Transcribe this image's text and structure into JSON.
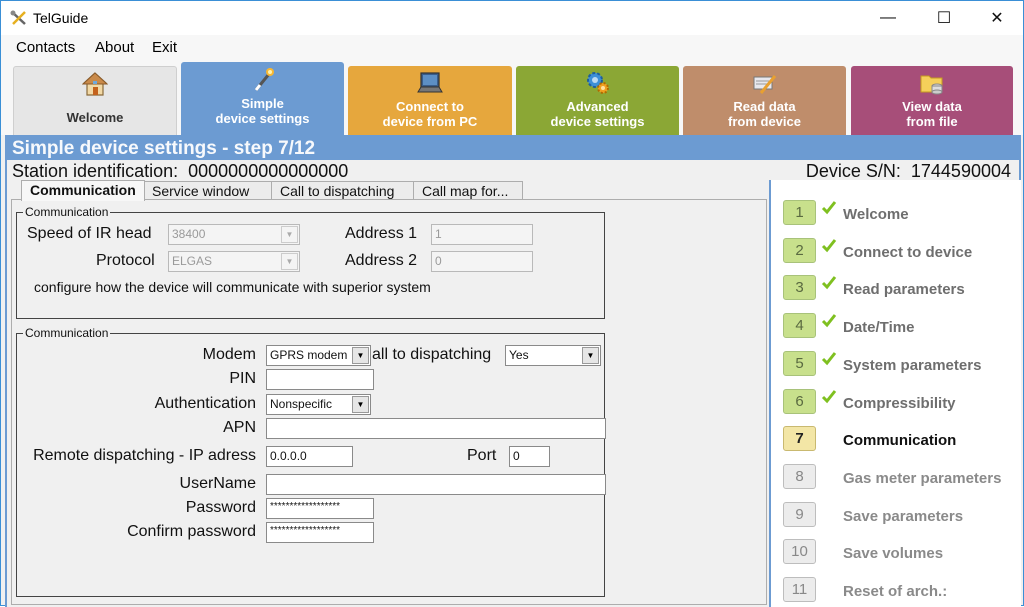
{
  "window": {
    "title": "TelGuide",
    "controls": {
      "minimize": "—",
      "maximize": "☐",
      "close": "✕"
    }
  },
  "menu": {
    "items": [
      "Contacts",
      "About",
      "Exit"
    ]
  },
  "ribbon": {
    "tabs": [
      {
        "label_line1": "Welcome",
        "label_line2": "",
        "icon": "house-icon",
        "color": "#e6e6e6"
      },
      {
        "label_line1": "Simple",
        "label_line2": "device settings",
        "icon": "magic-wand-icon",
        "color": "#6c9bd2",
        "active": true
      },
      {
        "label_line1": "Connect to",
        "label_line2": "device from PC",
        "icon": "laptop-icon",
        "color": "#e6a73d"
      },
      {
        "label_line1": "Advanced",
        "label_line2": "device settings",
        "icon": "gears-icon",
        "color": "#8ba735"
      },
      {
        "label_line1": "Read data",
        "label_line2": "from device",
        "icon": "read-pencil-icon",
        "color": "#bf8d6b"
      },
      {
        "label_line1": "View data",
        "label_line2": "from file",
        "icon": "folder-database-icon",
        "color": "#a74e79"
      }
    ]
  },
  "header": {
    "step_title": "Simple device settings - step 7/12",
    "station_label": "Station identification:",
    "station_value": "0000000000000000",
    "serial_label": "Device S/N:",
    "serial_value": "1744590004"
  },
  "tabs": [
    {
      "label": "Communication",
      "active": true
    },
    {
      "label": "Service window"
    },
    {
      "label": "Call to dispatching"
    },
    {
      "label": "Call map for..."
    }
  ],
  "group1": {
    "legend": "Communication",
    "speed_label": "Speed of IR head",
    "speed_value": "38400",
    "protocol_label": "Protocol",
    "protocol_value": "ELGAS",
    "address1_label": "Address 1",
    "address1_value": "1",
    "address2_label": "Address 2",
    "address2_value": "0",
    "description": "configure how the device will communicate with superior system"
  },
  "group2": {
    "legend": "Communication",
    "modem_label": "Modem",
    "modem_value": "GPRS modem",
    "call_label": "all to dispatching",
    "call_value": "Yes",
    "pin_label": "PIN",
    "pin_value": "",
    "auth_label": "Authentication",
    "auth_value": "Nonspecific",
    "apn_label": "APN",
    "apn_value": "",
    "ip_label": "Remote dispatching - IP adress",
    "ip_value": "0.0.0.0",
    "port_label": "Port",
    "port_value": "0",
    "username_label": "UserName",
    "username_value": "",
    "password_label": "Password",
    "password_value": "******************",
    "confirm_label": "Confirm password",
    "confirm_value": "******************"
  },
  "steps": [
    {
      "num": "1",
      "label": "Welcome",
      "status": "done"
    },
    {
      "num": "2",
      "label": "Connect to device",
      "status": "done"
    },
    {
      "num": "3",
      "label": "Read parameters",
      "status": "done"
    },
    {
      "num": "4",
      "label": "Date/Time",
      "status": "done"
    },
    {
      "num": "5",
      "label": "System parameters",
      "status": "done"
    },
    {
      "num": "6",
      "label": "Compressibility",
      "status": "done"
    },
    {
      "num": "7",
      "label": "Communication",
      "status": "current"
    },
    {
      "num": "8",
      "label": "Gas meter parameters",
      "status": "pending"
    },
    {
      "num": "9",
      "label": "Save parameters",
      "status": "pending"
    },
    {
      "num": "10",
      "label": "Save volumes",
      "status": "pending"
    },
    {
      "num": "11",
      "label": "Reset of arch.:",
      "status": "pending"
    }
  ],
  "colors": {
    "accent_blue": "#6c9bd2",
    "step_done": "#c8e08c",
    "step_current": "#f3e6a6",
    "step_pending": "#ececec",
    "check_green": "#7fc020"
  }
}
